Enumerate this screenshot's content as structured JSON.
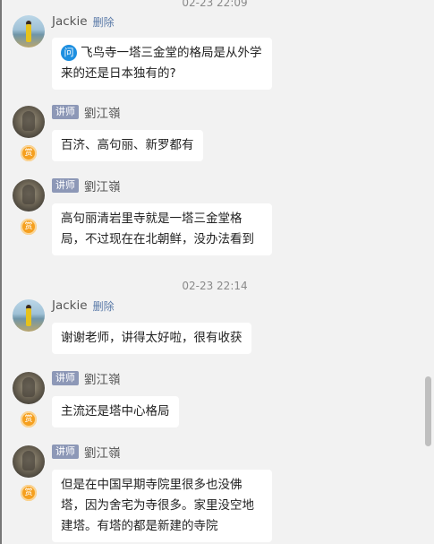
{
  "timestamps": {
    "t1": "02-23 22:09",
    "t2": "02-23 22:14"
  },
  "users": {
    "student": {
      "name": "Jackie",
      "delete_label": "删除"
    },
    "teacher": {
      "name": "劉江嶺",
      "role_tag": "讲师",
      "reward_label": "赏"
    }
  },
  "messages": {
    "m1": {
      "q_icon": "问",
      "text": "飞鸟寺一塔三金堂的格局是从外学来的还是日本独有的?"
    },
    "m2": {
      "text": "百济、高句丽、新罗都有"
    },
    "m3": {
      "text": "高句丽清岩里寺就是一塔三金堂格局，不过现在在北朝鲜，没办法看到"
    },
    "m4": {
      "text": "谢谢老师，讲得太好啦，很有收获"
    },
    "m5": {
      "text": "主流还是塔中心格局"
    },
    "m6": {
      "text": "但是在中国早期寺院里很多也没佛塔，因为舍宅为寺很多。家里没空地建塔。有塔的都是新建的寺院"
    }
  }
}
